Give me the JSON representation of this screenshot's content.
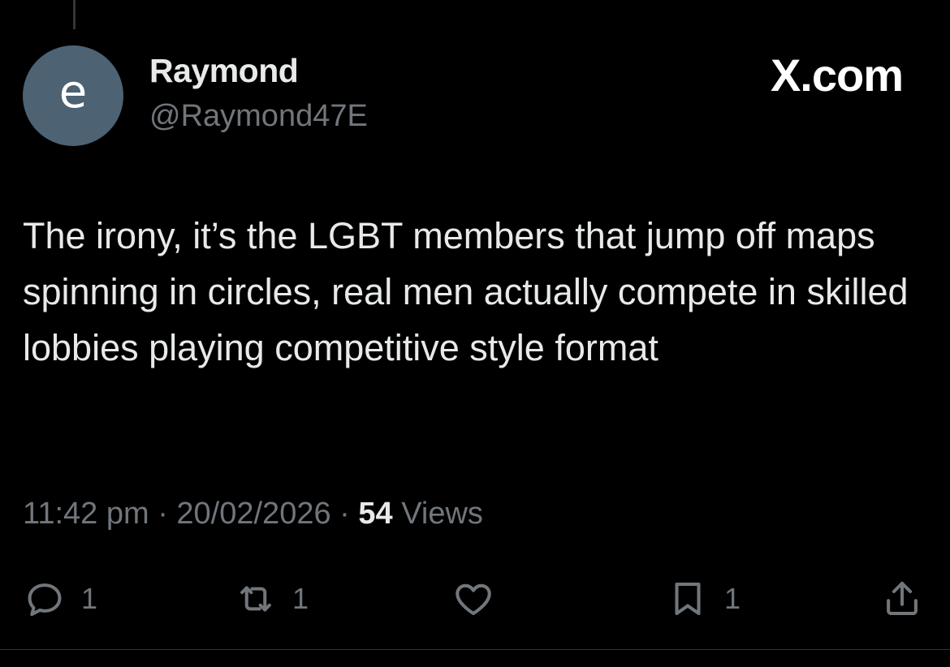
{
  "author": {
    "avatar_letter": "e",
    "avatar_color": "#4d6272",
    "display_name": "Raymond",
    "handle": "@Raymond47E"
  },
  "brand": {
    "label": "X.com"
  },
  "tweet": {
    "text": "The irony, it’s the LGBT members that jump off maps spinning in circles, real men actually compete in skilled lobbies playing competitive style format",
    "time": "11:42 pm",
    "separator": "·",
    "date": "20/02/2026",
    "views_count": "54",
    "views_label": "Views"
  },
  "actions": {
    "reply": {
      "icon": "reply-icon",
      "count": "1"
    },
    "repost": {
      "icon": "repost-icon",
      "count": "1"
    },
    "like": {
      "icon": "heart-icon",
      "count": ""
    },
    "bookmark": {
      "icon": "bookmark-icon",
      "count": "1"
    },
    "share": {
      "icon": "share-icon"
    }
  },
  "colors": {
    "background": "#000000",
    "text_primary": "#e7e9ea",
    "text_secondary": "#71767b"
  }
}
